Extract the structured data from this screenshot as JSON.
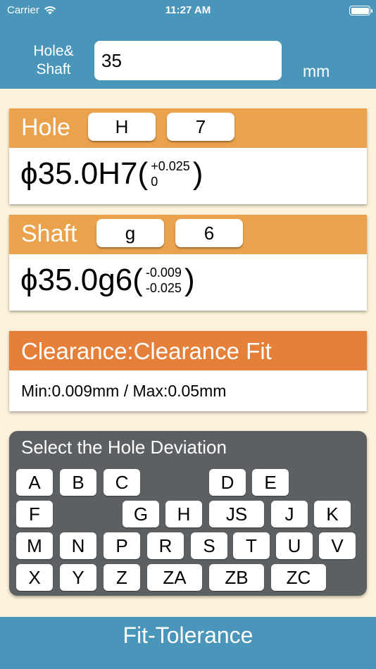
{
  "status": {
    "carrier": "Carrier",
    "time": "11:27 AM"
  },
  "input": {
    "label_line1": "Hole&",
    "label_line2": "Shaft",
    "value": "35",
    "unit": "mm"
  },
  "hole": {
    "title": "Hole",
    "letter": "H",
    "grade": "7",
    "designation": "ϕ35.0H7",
    "upper": "+0.025",
    "lower": "0"
  },
  "shaft": {
    "title": "Shaft",
    "letter": "g",
    "grade": "6",
    "designation": "ϕ35.0g6",
    "upper": "-0.009",
    "lower": "-0.025"
  },
  "paren_open": "(",
  "paren_close": ")",
  "fit": {
    "title": "Clearance:Clearance Fit",
    "detail": "Min:0.009mm / Max:0.05mm"
  },
  "keyboard": {
    "title": "Select the Hole Deviation",
    "keys": [
      "A",
      "B",
      "C",
      "D",
      "E",
      "F",
      "G",
      "H",
      "JS",
      "J",
      "K",
      "M",
      "N",
      "P",
      "R",
      "S",
      "T",
      "U",
      "V",
      "X",
      "Y",
      "Z",
      "ZA",
      "ZB",
      "ZC"
    ]
  },
  "footer": {
    "title": "Fit-Tolerance"
  },
  "colors": {
    "header_blue": "#4a95ba",
    "card_orange": "#eba24c",
    "fit_orange": "#e5803a",
    "keyboard_gray": "#5d6062",
    "background": "#fdf3dc"
  }
}
